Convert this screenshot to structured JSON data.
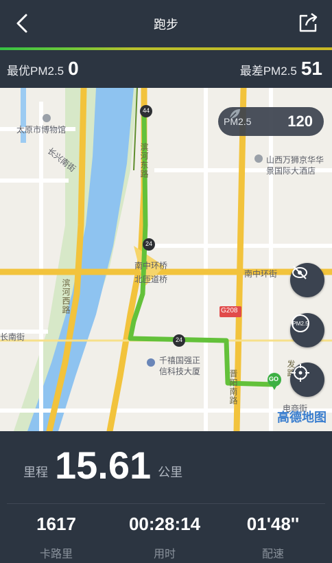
{
  "header": {
    "title": "跑步"
  },
  "pm": {
    "best_label": "最优PM2.5",
    "best_value": "0",
    "worst_label": "最差PM2.5",
    "worst_value": "51"
  },
  "map": {
    "labels": {
      "museum": "太原市博物馆",
      "changxing": "长兴南街",
      "binhe_east": "滨河东路",
      "binhe_west": "滨河西路",
      "interchange_1": "南中环桥",
      "interchange_2": "北匝道桥",
      "south_ring": "南中环街",
      "hotel_1": "山西万狮京华华",
      "hotel_2": "景国际大酒店",
      "road_g208": "G208",
      "building_1": "千禧国强正",
      "building_2": "信科技大厦",
      "yang_nan": "晋阳南路",
      "left_street": "长南街",
      "dian_street": "电商街",
      "fa_road": "发路",
      "road_badge_1": "44",
      "road_badge_2": "24",
      "road_badge_3": "24",
      "go": "GO",
      "amap": "高德地图"
    },
    "pm_chip": {
      "label": "PM2.5",
      "value": "120"
    },
    "buttons": {
      "hide": "hide-track",
      "pm": "PM2.5",
      "locate": "locate"
    }
  },
  "stats": {
    "distance_label": "里程",
    "distance_value": "15.61",
    "distance_unit": "公里",
    "calories_value": "1617",
    "calories_label": "卡路里",
    "time_value": "00:28:14",
    "time_label": "用时",
    "pace_value": "01'48''",
    "pace_label": "配速"
  },
  "colors": {
    "header_bg": "#2c3541",
    "track": "#63c13a",
    "road": "#f2c33c",
    "river": "#8ec3f0"
  }
}
